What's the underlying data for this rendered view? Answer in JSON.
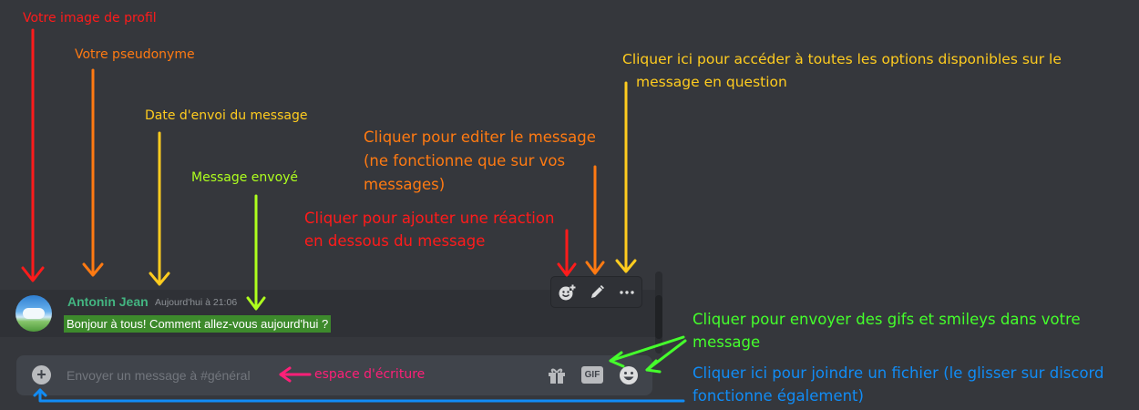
{
  "message": {
    "username": "Antonin Jean",
    "timestamp": "Aujourd'hui à 21:06",
    "text": "Bonjour à tous! Comment allez-vous aujourd'hui ?"
  },
  "toolbar": {
    "react_icon": "add-reaction-icon",
    "edit_icon": "pencil-icon",
    "more_icon": "more-options-icon"
  },
  "composer": {
    "placeholder": "Envoyer un message à #général",
    "attach_label": "+",
    "gif_label": "GIF"
  },
  "annotations": {
    "avatar": "Votre image de profil",
    "username": "Votre pseudonyme",
    "date": "Date d'envoi  du message",
    "sent": "Message envoyé",
    "options_line1": "Cliquer ici pour accéder à toutes les options disponibles sur le",
    "options_line2": "message en question",
    "edit_line1": "Cliquer pour editer le message",
    "edit_line2": "(ne fonctionne que sur vos",
    "edit_line3": "messages)",
    "react_line1": "Cliquer pour ajouter une réaction",
    "react_line2": "en dessous du message",
    "gif_line1": "Cliquer pour envoyer des gifs et smileys dans votre",
    "gif_line2": "message",
    "writing": "espace d'écriture",
    "attach_line1": "Cliquer ici pour joindre un fichier (le glisser sur discord",
    "attach_line2": "fonctionne également)"
  },
  "colors": {
    "background": "#35373c",
    "username": "#43b581",
    "red": "#ff1b1b",
    "orange": "#ff7a12",
    "yellow": "#ffcc1f",
    "lime": "#aeff1e",
    "green": "#45ff2c",
    "pink": "#ff1f78",
    "blue": "#118cf5"
  }
}
